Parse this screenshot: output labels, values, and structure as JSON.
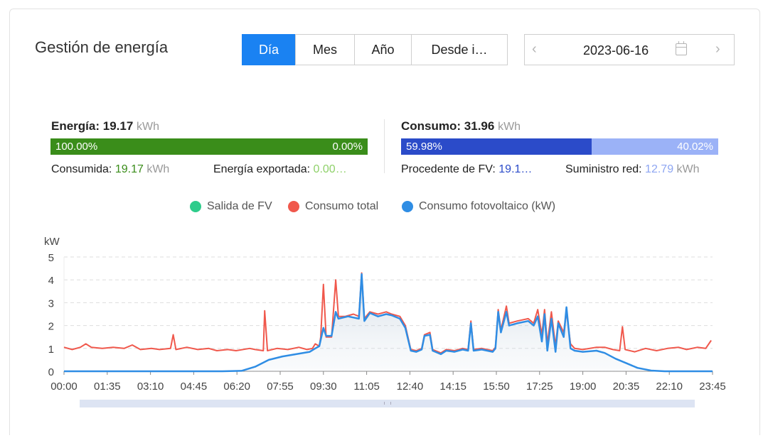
{
  "header": {
    "title": "Gestión de energía",
    "tabs": [
      {
        "label": "Día",
        "active": true
      },
      {
        "label": "Mes",
        "active": false
      },
      {
        "label": "Año",
        "active": false
      },
      {
        "label": "Desde i…",
        "active": false
      }
    ],
    "date": {
      "value": "2023-06-16",
      "prev_icon": "chevron-left-icon",
      "next_icon": "chevron-right-icon",
      "calendar_icon": "calendar-icon"
    }
  },
  "energy": {
    "label": "Energía:",
    "value": "19.17",
    "unit": "kWh",
    "bar": {
      "left_pct": "100.00%",
      "right_pct": "0.00%",
      "left_fraction": 1.0,
      "left_color": "#3a8d1a",
      "right_color": "#a2d46c"
    },
    "consumed_label": "Consumida:",
    "consumed_value": "19.17",
    "consumed_unit": "kWh",
    "consumed_color": "#3a8d1a",
    "exported_label": "Energía exportada:",
    "exported_value": "0.00…",
    "exported_color": "#8fd16a"
  },
  "consumption": {
    "label": "Consumo:",
    "value": "31.96",
    "unit": "kWh",
    "bar": {
      "left_pct": "59.98%",
      "right_pct": "40.02%",
      "left_fraction": 0.5998,
      "left_color": "#2b4bc9",
      "right_color": "#9bb2f7"
    },
    "pv_label": "Procedente de FV:",
    "pv_value": "19.1…",
    "pv_color": "#2b4bc9",
    "grid_label": "Suministro red:",
    "grid_value": "12.79",
    "grid_unit": "kWh",
    "grid_color": "#8ea6f2"
  },
  "chart_data": {
    "type": "line",
    "ylabel": "kW",
    "ylim": [
      0,
      5
    ],
    "yticks": [
      "0",
      "1",
      "2",
      "3",
      "4",
      "5"
    ],
    "xlim_hours": [
      0,
      23.75
    ],
    "xticks": [
      "00:00",
      "01:35",
      "03:10",
      "04:45",
      "06:20",
      "07:55",
      "09:30",
      "11:05",
      "12:40",
      "14:15",
      "15:50",
      "17:25",
      "19:00",
      "20:35",
      "22:10",
      "23:45"
    ],
    "grid": "horizontal dashed",
    "legend_position": "top-center",
    "series": [
      {
        "name": "Salida de FV",
        "color": "#2ecc8b",
        "points": []
      },
      {
        "name": "Consumo total",
        "color": "#f0584c",
        "points": [
          [
            0,
            1.05
          ],
          [
            0.3,
            0.95
          ],
          [
            0.6,
            1.05
          ],
          [
            0.8,
            1.2
          ],
          [
            1.0,
            1.05
          ],
          [
            1.4,
            1.0
          ],
          [
            1.8,
            1.05
          ],
          [
            2.2,
            1.0
          ],
          [
            2.5,
            1.15
          ],
          [
            2.8,
            0.95
          ],
          [
            3.2,
            1.0
          ],
          [
            3.5,
            0.95
          ],
          [
            3.9,
            1.0
          ],
          [
            4.0,
            1.6
          ],
          [
            4.1,
            0.95
          ],
          [
            4.5,
            1.05
          ],
          [
            4.9,
            0.95
          ],
          [
            5.3,
            1.0
          ],
          [
            5.6,
            0.9
          ],
          [
            6.0,
            0.95
          ],
          [
            6.3,
            0.9
          ],
          [
            6.8,
            1.0
          ],
          [
            7.0,
            0.95
          ],
          [
            7.3,
            0.9
          ],
          [
            7.35,
            2.65
          ],
          [
            7.45,
            0.9
          ],
          [
            7.8,
            1.0
          ],
          [
            8.2,
            0.95
          ],
          [
            8.6,
            1.05
          ],
          [
            8.9,
            0.95
          ],
          [
            9.1,
            1.0
          ],
          [
            9.2,
            1.2
          ],
          [
            9.35,
            1.1
          ],
          [
            9.4,
            1.5
          ],
          [
            9.5,
            3.8
          ],
          [
            9.6,
            1.5
          ],
          [
            9.8,
            1.5
          ],
          [
            9.95,
            4.0
          ],
          [
            10.05,
            2.4
          ],
          [
            10.3,
            2.4
          ],
          [
            10.6,
            2.5
          ],
          [
            10.8,
            2.4
          ],
          [
            10.9,
            4.3
          ],
          [
            11.0,
            2.3
          ],
          [
            11.2,
            2.6
          ],
          [
            11.5,
            2.5
          ],
          [
            11.8,
            2.6
          ],
          [
            12.0,
            2.5
          ],
          [
            12.3,
            2.4
          ],
          [
            12.5,
            2.0
          ],
          [
            12.7,
            0.95
          ],
          [
            12.9,
            0.9
          ],
          [
            13.1,
            1.0
          ],
          [
            13.2,
            1.6
          ],
          [
            13.4,
            1.7
          ],
          [
            13.5,
            0.95
          ],
          [
            13.8,
            0.8
          ],
          [
            14.0,
            0.95
          ],
          [
            14.3,
            0.9
          ],
          [
            14.6,
            1.0
          ],
          [
            14.8,
            0.95
          ],
          [
            14.9,
            2.2
          ],
          [
            15.0,
            0.95
          ],
          [
            15.3,
            1.0
          ],
          [
            15.7,
            0.9
          ],
          [
            15.8,
            1.05
          ],
          [
            15.9,
            2.7
          ],
          [
            16.0,
            1.8
          ],
          [
            16.2,
            2.85
          ],
          [
            16.3,
            2.1
          ],
          [
            16.6,
            2.2
          ],
          [
            17.0,
            2.3
          ],
          [
            17.2,
            2.1
          ],
          [
            17.35,
            2.7
          ],
          [
            17.5,
            1.6
          ],
          [
            17.6,
            2.7
          ],
          [
            17.7,
            1.2
          ],
          [
            17.85,
            2.6
          ],
          [
            18.0,
            1.1
          ],
          [
            18.1,
            2.2
          ],
          [
            18.3,
            1.7
          ],
          [
            18.4,
            2.6
          ],
          [
            18.55,
            1.2
          ],
          [
            18.7,
            1.0
          ],
          [
            19.0,
            0.95
          ],
          [
            19.5,
            1.05
          ],
          [
            19.8,
            1.05
          ],
          [
            20.1,
            0.95
          ],
          [
            20.35,
            0.9
          ],
          [
            20.45,
            1.95
          ],
          [
            20.55,
            0.95
          ],
          [
            20.9,
            0.85
          ],
          [
            21.3,
            1.0
          ],
          [
            21.7,
            0.9
          ],
          [
            22.1,
            1.0
          ],
          [
            22.5,
            1.05
          ],
          [
            22.8,
            0.95
          ],
          [
            23.2,
            1.05
          ],
          [
            23.5,
            1.0
          ],
          [
            23.7,
            1.35
          ]
        ]
      },
      {
        "name": "Consumo fotovoltaico (kW)",
        "color": "#2f8de4",
        "points": [
          [
            0,
            0
          ],
          [
            5.8,
            0
          ],
          [
            6.5,
            0.02
          ],
          [
            7.0,
            0.2
          ],
          [
            7.5,
            0.5
          ],
          [
            8.0,
            0.65
          ],
          [
            8.5,
            0.75
          ],
          [
            9.0,
            0.85
          ],
          [
            9.2,
            1.0
          ],
          [
            9.35,
            1.1
          ],
          [
            9.5,
            1.9
          ],
          [
            9.6,
            1.55
          ],
          [
            9.8,
            1.55
          ],
          [
            9.95,
            2.6
          ],
          [
            10.05,
            2.3
          ],
          [
            10.4,
            2.4
          ],
          [
            10.8,
            2.3
          ],
          [
            10.9,
            4.25
          ],
          [
            11.0,
            2.2
          ],
          [
            11.2,
            2.55
          ],
          [
            11.5,
            2.4
          ],
          [
            11.8,
            2.5
          ],
          [
            12.0,
            2.45
          ],
          [
            12.3,
            2.3
          ],
          [
            12.5,
            1.9
          ],
          [
            12.7,
            0.9
          ],
          [
            12.9,
            0.85
          ],
          [
            13.1,
            0.95
          ],
          [
            13.2,
            1.55
          ],
          [
            13.4,
            1.6
          ],
          [
            13.5,
            0.9
          ],
          [
            13.8,
            0.75
          ],
          [
            14.0,
            0.9
          ],
          [
            14.3,
            0.85
          ],
          [
            14.6,
            0.95
          ],
          [
            14.8,
            0.9
          ],
          [
            14.9,
            2.1
          ],
          [
            15.0,
            0.9
          ],
          [
            15.3,
            0.95
          ],
          [
            15.7,
            0.85
          ],
          [
            15.8,
            1.0
          ],
          [
            15.9,
            2.6
          ],
          [
            16.0,
            1.7
          ],
          [
            16.2,
            2.6
          ],
          [
            16.3,
            2.0
          ],
          [
            16.6,
            2.1
          ],
          [
            17.0,
            2.2
          ],
          [
            17.2,
            2.0
          ],
          [
            17.35,
            2.4
          ],
          [
            17.5,
            1.3
          ],
          [
            17.6,
            2.5
          ],
          [
            17.7,
            0.9
          ],
          [
            17.85,
            2.3
          ],
          [
            18.0,
            0.85
          ],
          [
            18.1,
            2.1
          ],
          [
            18.3,
            1.5
          ],
          [
            18.4,
            2.8
          ],
          [
            18.55,
            1.0
          ],
          [
            18.7,
            0.9
          ],
          [
            19.0,
            0.85
          ],
          [
            19.5,
            0.9
          ],
          [
            19.8,
            0.8
          ],
          [
            20.2,
            0.55
          ],
          [
            20.6,
            0.35
          ],
          [
            21.0,
            0.15
          ],
          [
            21.5,
            0.03
          ],
          [
            22.0,
            0
          ],
          [
            23.75,
            0
          ]
        ]
      }
    ]
  }
}
